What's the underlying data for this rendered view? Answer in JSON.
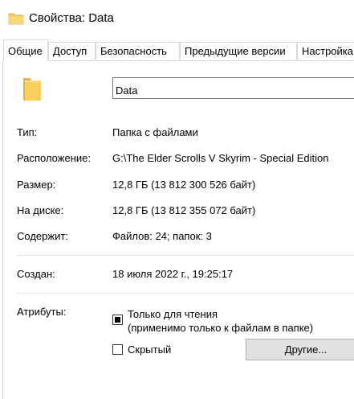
{
  "window": {
    "title": "Свойства: Data"
  },
  "tabs": [
    {
      "label": "Общие"
    },
    {
      "label": "Доступ"
    },
    {
      "label": "Безопасность"
    },
    {
      "label": "Предыдущие версии"
    },
    {
      "label": "Настройка"
    }
  ],
  "general": {
    "name_value": "Data",
    "type": {
      "label": "Тип:",
      "value": "Папка с файлами"
    },
    "location": {
      "label": "Расположение:",
      "value": "G:\\The Elder Scrolls V Skyrim - Special Edition"
    },
    "size": {
      "label": "Размер:",
      "value": "12,8 ГБ (13 812 300 526 байт)"
    },
    "size_on_disk": {
      "label": "На диске:",
      "value": "12,8 ГБ (13 812 355 072 байт)"
    },
    "contains": {
      "label": "Содержит:",
      "value": "Файлов: 24; папок: 3"
    },
    "created": {
      "label": "Создан:",
      "value": "18 июля 2022 г., 19:25:17"
    },
    "attributes": {
      "label": "Атрибуты:",
      "readonly_label_line1": "Только для чтения",
      "readonly_label_line2": "(применимо только к файлам в папке)",
      "readonly_state": "indeterminate",
      "hidden_label": "Скрытый",
      "hidden_checked": false,
      "advanced_button": "Другие..."
    }
  },
  "colors": {
    "folder": "#f4c95a",
    "folder_dark": "#e0a82e",
    "border": "#d9d9d9",
    "button_bg": "#e1e1e1"
  }
}
